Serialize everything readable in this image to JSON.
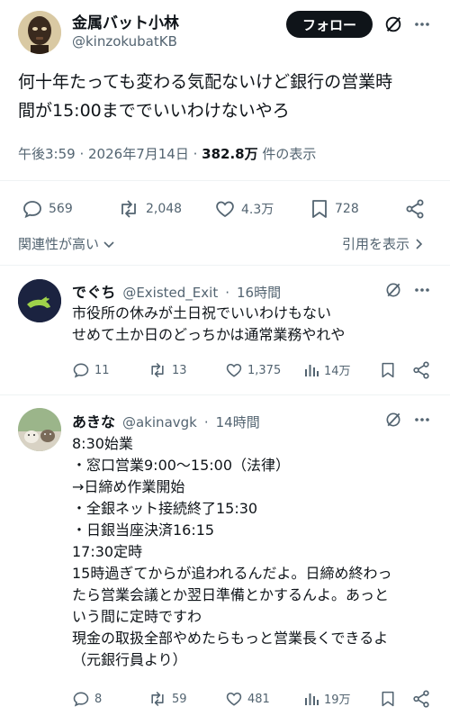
{
  "main_tweet": {
    "author_name": "金属バット小林",
    "author_handle": "@kinzokubatKB",
    "follow_label": "フォロー",
    "text_lines": [
      "何十年たっても変わる気配ないけど銀行の営業時",
      "間が15:00まででいいわけないやろ"
    ],
    "time": "午後3:59",
    "date": "2026年7月14日",
    "views_count": "382.8万",
    "views_label": "件の表示",
    "actions": {
      "replies": "569",
      "retweets": "2,048",
      "likes": "4.3万",
      "bookmarks": "728"
    },
    "relevance_label": "関連性が高い",
    "quote_label": "引用を表示"
  },
  "replies": [
    {
      "name": "でぐち",
      "handle": "@Existed_Exit",
      "time": "16時間",
      "text_lines": [
        "市役所の休みが土日祝でいいわけもない",
        "せめて土か日のどっちかは通常業務やれや"
      ],
      "actions": {
        "replies": "11",
        "retweets": "13",
        "likes": "1,375",
        "views": "14万"
      }
    },
    {
      "name": "あきな",
      "handle": "@akinavgk",
      "time": "14時間",
      "text_lines": [
        "8:30始業",
        "・窓口営業9:00〜15:00（法律）",
        "→日締め作業開始",
        "・全銀ネット接続終了15:30",
        "・日銀当座決済16:15",
        "17:30定時",
        "15時過ぎてからが追われるんだよ。日締め終わっ",
        "たら営業会議とか翌日準備とかするんよ。あっと",
        "いう間に定時ですわ",
        "現金の取扱全部やめたらもっと営業長くできるよ",
        "（元銀行員より）"
      ],
      "actions": {
        "replies": "8",
        "retweets": "59",
        "likes": "481",
        "views": "19万"
      }
    }
  ],
  "colors": {
    "text": "#0f1419",
    "muted": "#536471",
    "divider": "#eff3f4",
    "button": "#0f1419"
  },
  "icons": [
    "grok-icon",
    "more-icon",
    "reply-icon",
    "retweet-icon",
    "like-icon",
    "bookmark-icon",
    "share-icon",
    "views-icon",
    "chevron-down-icon"
  ]
}
